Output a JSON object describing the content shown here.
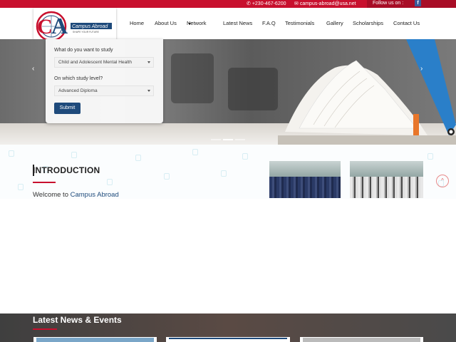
{
  "topbar": {
    "phone": "+230-467-6200",
    "email": "campus-abroad@usa.net",
    "follow": "Follow us on :",
    "facebook_glyph": "f"
  },
  "logo": {
    "letters": "CA",
    "name": "Campus Abroad",
    "tagline": "SHAPE YOUR FUTURE"
  },
  "nav": {
    "items": [
      "Home",
      "About Us",
      "Network",
      "Latest News",
      "F.A.Q",
      "Testimonials",
      "Gallery",
      "Scholarships",
      "Contact Us"
    ]
  },
  "search": {
    "study_label": "What do you want to study",
    "study_value": "Child and Adolescent Mental Health",
    "level_label": "On which study level?",
    "level_value": "Advanced Diploma",
    "submit": "Submit"
  },
  "slider": {
    "prev": "‹",
    "next": "›"
  },
  "intro": {
    "title": "INTRODUCTION",
    "welcome_prefix": "Welcome to ",
    "welcome_brand": "Campus Abroad",
    "to_top": "^"
  },
  "news": {
    "title": "Latest News & Events"
  },
  "colors": {
    "brand_red": "#c8102e",
    "brand_blue": "#1e4a7b"
  }
}
